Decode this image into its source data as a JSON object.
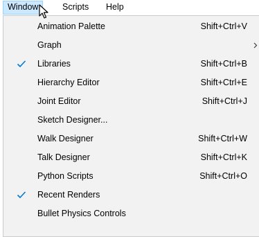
{
  "menubar": {
    "items": [
      {
        "label": "Window"
      },
      {
        "label": "Scripts"
      },
      {
        "label": "Help"
      }
    ]
  },
  "window_menu": {
    "items": [
      {
        "label": "Animation Palette",
        "shortcut": "Shift+Ctrl+V",
        "checked": false
      },
      {
        "label": "Graph",
        "shortcut": "",
        "checked": false,
        "submenu": true
      },
      {
        "label": "Libraries",
        "shortcut": "Shift+Ctrl+B",
        "checked": true
      },
      {
        "label": "Hierarchy Editor",
        "shortcut": "Shift+Ctrl+E",
        "checked": false
      },
      {
        "label": "Joint Editor",
        "shortcut": "Shift+Ctrl+J",
        "checked": false
      },
      {
        "label": "Sketch Designer...",
        "shortcut": "",
        "checked": false
      },
      {
        "label": "Walk Designer",
        "shortcut": "Shift+Ctrl+W",
        "checked": false
      },
      {
        "label": "Talk Designer",
        "shortcut": "Shift+Ctrl+K",
        "checked": false
      },
      {
        "label": "Python Scripts",
        "shortcut": "Shift+Ctrl+O",
        "checked": false
      },
      {
        "label": "Recent Renders",
        "shortcut": "",
        "checked": true
      },
      {
        "label": "Bullet Physics Controls",
        "shortcut": "",
        "checked": false
      }
    ]
  },
  "colors": {
    "menu_background": "#f2f2f2",
    "menubar_active_background": "#cce8ff",
    "menubar_active_border": "#99d1ff",
    "checkmark": "#0078d7"
  },
  "icons": {
    "checkmark": "checkmark-icon",
    "submenu_arrow": "chevron-right-icon",
    "cursor": "mouse-pointer-icon"
  }
}
